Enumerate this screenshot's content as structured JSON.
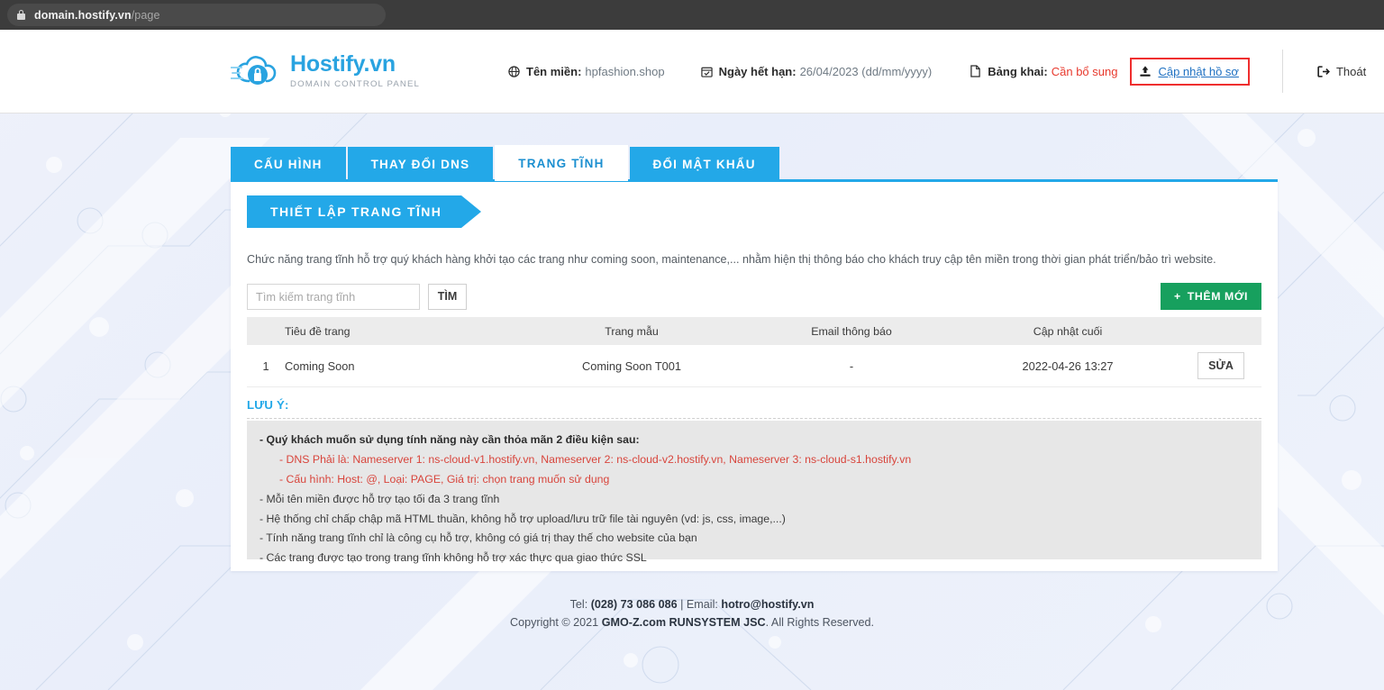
{
  "browser": {
    "url_domain": "domain.hostify.vn",
    "url_path": "/page",
    "lock_icon": "lock-icon"
  },
  "header": {
    "logo_title": "Hostify.vn",
    "logo_subtitle": "DOMAIN CONTROL PANEL",
    "logo_icon": "cloud-lock-icon",
    "domain": {
      "icon": "globe-icon",
      "label": "Tên miền:",
      "value": "hpfashion.shop"
    },
    "expiry": {
      "icon": "calendar-icon",
      "label": "Ngày hết hạn:",
      "value": "26/04/2023 (dd/mm/yyyy)"
    },
    "declaration": {
      "icon": "document-icon",
      "label": "Bảng khai:",
      "value": "Cần bổ sung",
      "value_color": "#e8392d"
    },
    "update_profile": {
      "icon": "upload-icon",
      "label": "Cập nhật hồ sơ",
      "highlight_color": "#ef2e2e"
    },
    "logout": {
      "icon": "sign-out-icon",
      "label": "Thoát"
    }
  },
  "tabs": [
    {
      "label": "CẤU HÌNH",
      "active": false
    },
    {
      "label": "THAY ĐỔI DNS",
      "active": false
    },
    {
      "label": "TRANG TĨNH",
      "active": true
    },
    {
      "label": "ĐỔI MẬT KHẨU",
      "active": false
    }
  ],
  "section": {
    "banner_title": "THIẾT LẬP TRANG TĨNH",
    "description": "Chức năng trang tĩnh hỗ trợ quý khách hàng khởi tạo các trang như coming soon, maintenance,... nhằm hiện thị thông báo cho khách truy cập tên miền trong thời gian phát triển/bảo trì website."
  },
  "toolbar": {
    "search_placeholder": "Tìm kiếm trang tĩnh",
    "search_value": "",
    "search_button": "TÌM",
    "add_button": "THÊM MỚI",
    "add_button_icon": "plus-icon",
    "add_button_color": "#17a05e"
  },
  "table": {
    "columns": [
      "",
      "Tiêu đề trang",
      "Trang mẫu",
      "Email thông báo",
      "Cập nhật cuối",
      ""
    ],
    "rows": [
      {
        "index": "1",
        "title": "Coming Soon",
        "template": "Coming Soon T001",
        "email": "-",
        "updated": "2022-04-26 13:27",
        "action": "SỬA"
      }
    ]
  },
  "notes": {
    "title": "LƯU Ý:",
    "items": [
      {
        "text": "- Quý khách muốn sử dụng tính năng này cần thỏa mãn 2 điều kiện sau:",
        "style": "bold"
      },
      {
        "text": "- DNS Phải là: Nameserver 1: ns-cloud-v1.hostify.vn, Nameserver 2: ns-cloud-v2.hostify.vn, Nameserver 3: ns-cloud-s1.hostify.vn",
        "style": "red"
      },
      {
        "text": "- Cấu hình: Host: @, Loại: PAGE, Giá trị: chọn trang muốn sử dụng",
        "style": "red"
      },
      {
        "text": "- Mỗi tên miền được hỗ trợ tạo tối đa 3 trang tĩnh",
        "style": "normal"
      },
      {
        "text": "- Hệ thống chỉ chấp chập mã HTML thuần, không hỗ trợ upload/lưu trữ file tài nguyên (vd: js, css, image,...)",
        "style": "normal"
      },
      {
        "text": "- Tính năng trang tĩnh chỉ là công cụ hỗ trợ, không có giá trị thay thế cho website của bạn",
        "style": "normal"
      },
      {
        "text": "- Các trang được tạo trong trang tĩnh không hỗ trợ xác thực qua giao thức SSL",
        "style": "normal"
      }
    ]
  },
  "footer": {
    "line1_prefix": "Tel: ",
    "line1_phone": "(028) 73 086 086",
    "line1_mid": " | Email: ",
    "line1_email": "hotro@hostify.vn",
    "line2_prefix": "Copyright © 2021 ",
    "line2_company": "GMO-Z.com RUNSYSTEM JSC",
    "line2_suffix": ". All Rights Reserved."
  },
  "theme": {
    "accent_blue": "#23a8e8",
    "green": "#17a05e",
    "red": "#e8392d",
    "link_blue": "#2071c2"
  }
}
